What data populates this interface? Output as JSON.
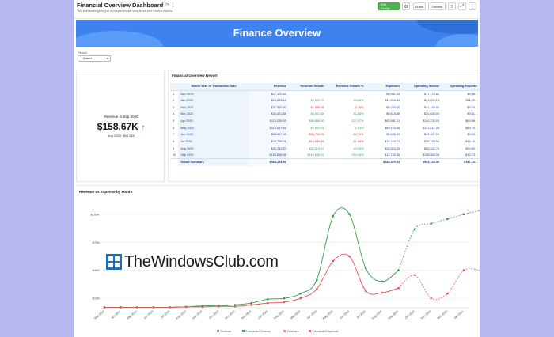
{
  "header": {
    "title": "Financial Overview Dashboard",
    "subtitle": "This dashboard gives you a comprehensive view about core finance reports",
    "buttons": {
      "edit": "Edit Design",
      "share": "Share",
      "themes": "Themes"
    }
  },
  "banner": {
    "title": "Finance Overview"
  },
  "filter": {
    "label": "Period",
    "value": "-- Select --"
  },
  "kpi": {
    "title": "Revenue in Sep 2020",
    "value": "$158.67K",
    "trend": "↑",
    "comparison": "Aug 2020: $40.24K"
  },
  "report": {
    "title": "Financial Overview Report",
    "columns": [
      "",
      "Month-Year of Transaction Date",
      "Revenue",
      "Revenue Growth",
      "Revenue Growth %",
      "Expenses",
      "Operating Income",
      "Operating Expense"
    ],
    "rows": [
      [
        "1",
        "Dec 2019",
        "$17,170.62",
        "",
        "",
        "$9,982.29",
        "$17,170.62",
        "$9,98..."
      ],
      [
        "2",
        "Jan 2020",
        "$23,093.13",
        "$6,922.70",
        "25.68%",
        "$11,226.84",
        "$23,093.13",
        "$11,22..."
      ],
      [
        "3",
        "Feb 2020",
        "$21,550.00",
        "-$1,558.38",
        "-6.78%",
        "$9,230.40",
        "$21,430.00",
        "$9,23..."
      ],
      [
        "4",
        "Mar 2020",
        "$30,421.88",
        "$8,987.88",
        "41.85%",
        "$9,815.88",
        "$30,608.00",
        "$9,81..."
      ],
      [
        "5",
        "Apr 2020",
        "$110,255.93",
        "$69,856.00",
        "221.57%",
        "$63,981.31",
        "$110,226.93",
        "$63,98..."
      ],
      [
        "6",
        "May 2020",
        "$113,917.94",
        "$1,991.01",
        "1.93%",
        "$69,133.46",
        "$101,817.06",
        "$69,13..."
      ],
      [
        "7",
        "Jun 2020",
        "$42,167.99",
        "-$56,769.95",
        "-56.70%",
        "$9,638.09",
        "$42,167.99",
        "$9,63..."
      ],
      [
        "8",
        "Jul 2020",
        "$28,758.54",
        "-$13,939.45",
        "-31.68%",
        "$16,104.72",
        "$28,758.54",
        "$16,10..."
      ],
      [
        "9",
        "Aug 2020",
        "$40,242.70",
        "$11,514.37",
        "40.00%",
        "$20,604.29",
        "$40,242.70",
        "$20,60..."
      ],
      [
        "10",
        "Sep 2020",
        "$158,668.98",
        "$115,426.02",
        "294.28%",
        "$12,730.36",
        "$158,668.98",
        "$12,73..."
      ]
    ],
    "total": [
      "",
      "Grand Summary",
      "$564,254.56",
      "",
      "",
      "$188,879.34",
      "$564,134.56",
      "$187,13..."
    ]
  },
  "chart_data": {
    "type": "line",
    "title": "Revenue vs Expense by Month",
    "y_ticks": [
      "$10K",
      "$40K",
      "$70K",
      "$100K"
    ],
    "ylim": [
      0,
      110
    ],
    "categories": [
      "Mar 2019",
      "Apr 2019",
      "May 2019",
      "Jun 2019",
      "Jul 2019",
      "Aug 2019",
      "Sep 2019",
      "Oct 2019",
      "Nov 2019",
      "Dec 2019",
      "Jan 2020",
      "Feb 2020",
      "Mar 2020",
      "Apr 2020",
      "May 2020",
      "Jun 2020",
      "Jul 2020",
      "Aug 2020",
      "Sep 2020",
      "Oct 2020",
      "Nov 2020",
      "Dec 2020",
      "Jan 2021"
    ],
    "series": [
      {
        "name": "Revenue",
        "color": "#2e9e47",
        "start": 0,
        "values": [
          0.5,
          0.5,
          0.5,
          0.5,
          0.5,
          1,
          2,
          2,
          3,
          5,
          9,
          10,
          15,
          30,
          98,
          100,
          42,
          28,
          40
        ]
      },
      {
        "name": "Forecasted Revenue",
        "color": "#2e9e47",
        "dashed": true,
        "start": 18,
        "values": [
          40,
          84,
          90,
          95,
          100,
          104
        ]
      },
      {
        "name": "Expenses",
        "color": "#e05454",
        "start": 0,
        "values": [
          0.5,
          0.5,
          0.5,
          0.5,
          0.5,
          1,
          1,
          1.5,
          1.5,
          3,
          5,
          6,
          10,
          20,
          50,
          55,
          18,
          16,
          21
        ]
      },
      {
        "name": "Forecasted Expenses",
        "color": "#e05454",
        "dashed": true,
        "start": 18,
        "values": [
          21,
          35,
          10,
          15,
          40,
          40
        ]
      }
    ],
    "legend": [
      "Revenue",
      "Forecasted Revenue",
      "Expenses",
      "Forecasted Expenses"
    ],
    "legend_position": "bottom-center"
  },
  "watermark": {
    "text": "TheWindowsClub.com"
  }
}
